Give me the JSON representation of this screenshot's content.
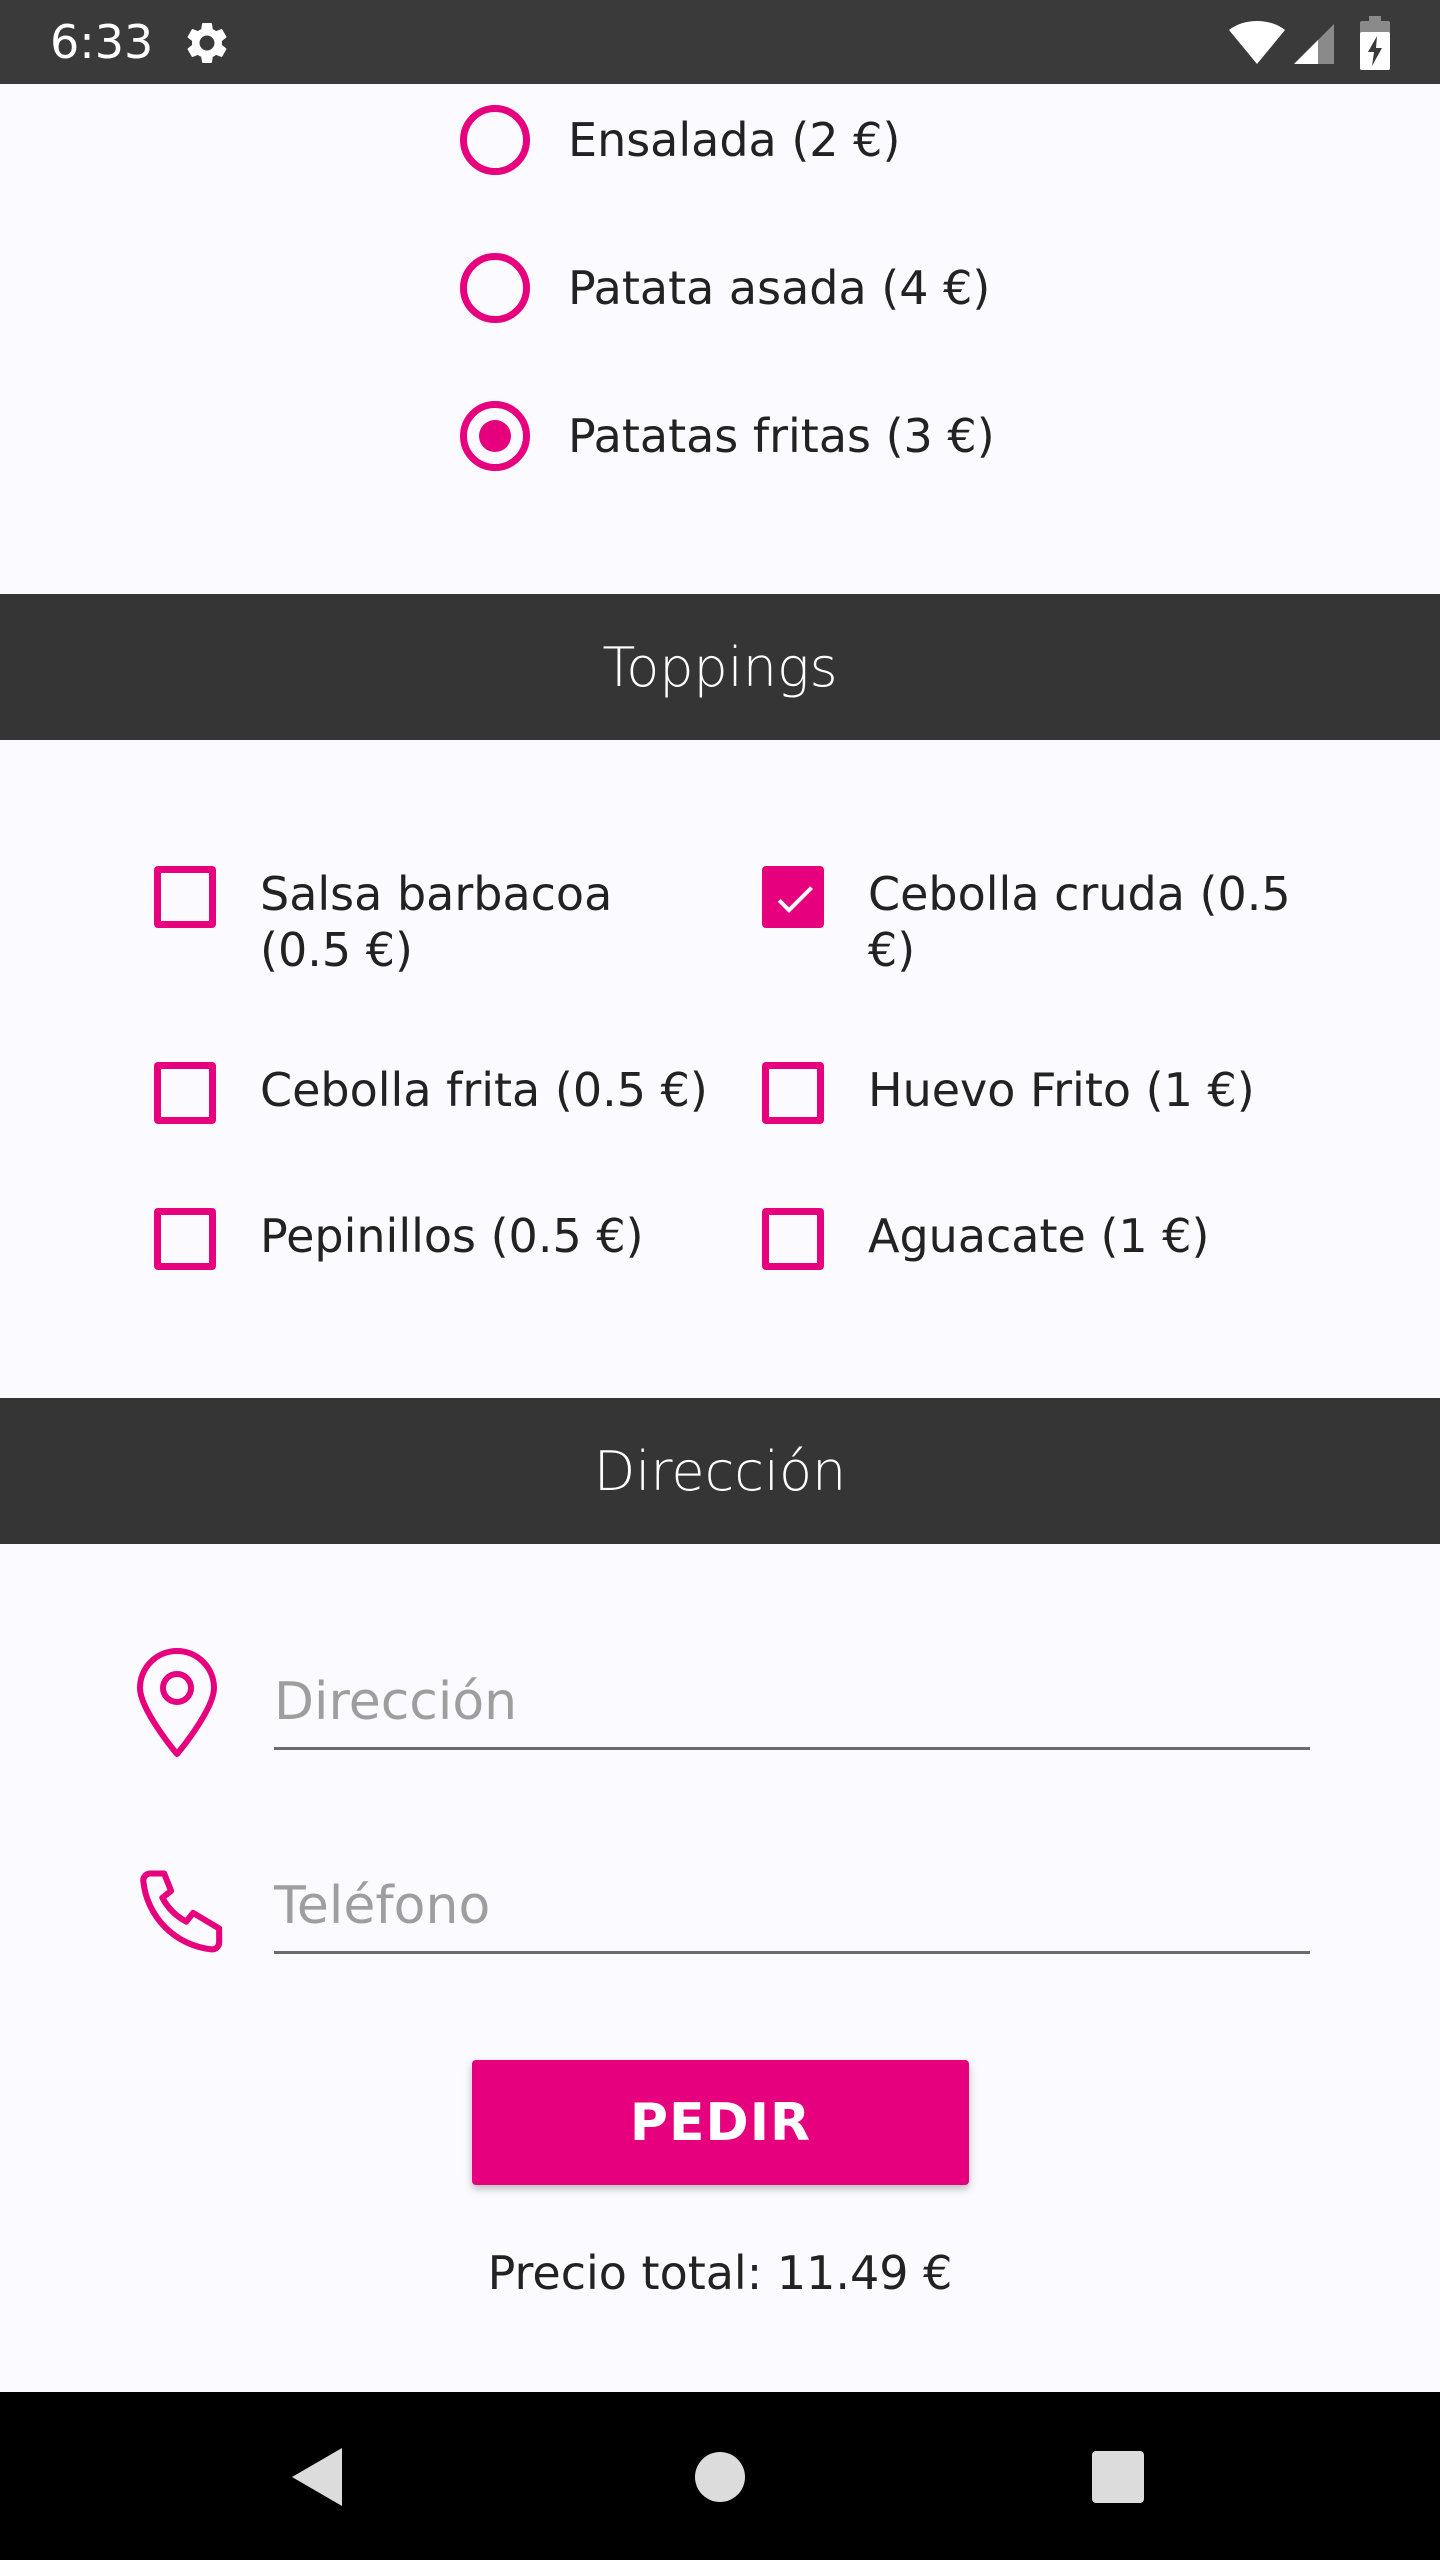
{
  "status_bar": {
    "time": "6:33"
  },
  "sides": {
    "options": [
      {
        "label": "Ensalada (2 €)",
        "checked": false
      },
      {
        "label": "Patata asada (4 €)",
        "checked": false
      },
      {
        "label": "Patatas fritas (3 €)",
        "checked": true
      }
    ]
  },
  "toppings": {
    "title": "Toppings",
    "items": [
      {
        "label": "Salsa barbacoa (0.5 €)",
        "checked": false
      },
      {
        "label": "Cebolla cruda (0.5 €)",
        "checked": true
      },
      {
        "label": "Cebolla frita (0.5 €)",
        "checked": false
      },
      {
        "label": "Huevo Frito (1 €)",
        "checked": false
      },
      {
        "label": "Pepinillos (0.5 €)",
        "checked": false
      },
      {
        "label": "Aguacate (1 €)",
        "checked": false
      }
    ]
  },
  "address": {
    "title": "Dirección",
    "address_field": {
      "placeholder": "Dirección",
      "value": ""
    },
    "phone_field": {
      "placeholder": "Teléfono",
      "value": ""
    }
  },
  "order_button": {
    "label": "PEDIR"
  },
  "total": {
    "text": "Precio total: 11.49 €"
  },
  "colors": {
    "accent": "#e6007e",
    "header_bg": "#353535",
    "status_bg": "#3a3a3a",
    "background": "#fafaff"
  },
  "icons": {
    "status": [
      "gear-icon",
      "wifi-icon",
      "signal-icon",
      "battery-icon"
    ],
    "fields": [
      "location-pin-icon",
      "phone-icon"
    ],
    "navigation": [
      "back-icon",
      "home-icon",
      "recents-icon"
    ]
  }
}
